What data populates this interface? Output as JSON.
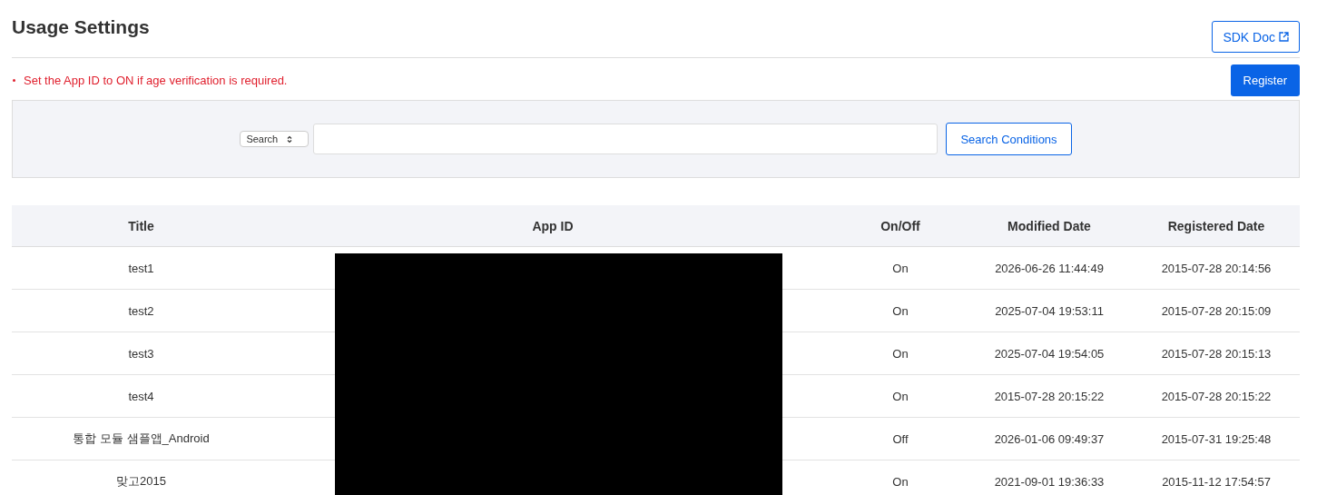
{
  "page": {
    "title": "Usage Settings",
    "doc_button": "SDK Doc",
    "notice": "Set the App ID to ON if age verification is required.",
    "register_button": "Register"
  },
  "search": {
    "select": "Search",
    "button": "Search Conditions"
  },
  "table": {
    "columns": [
      "Title",
      "App ID",
      "On/Off",
      "Modified Date",
      "Registered Date"
    ],
    "rows": [
      {
        "title": "test1",
        "on_off": "On",
        "modified": "2026-06-26 11:44:49",
        "registered": "2015-07-28 20:14:56"
      },
      {
        "title": "test2",
        "on_off": "On",
        "modified": "2025-07-04 19:53:11",
        "registered": "2015-07-28 20:15:09"
      },
      {
        "title": "test3",
        "on_off": "On",
        "modified": "2025-07-04 19:54:05",
        "registered": "2015-07-28 20:15:13"
      },
      {
        "title": "test4",
        "on_off": "On",
        "modified": "2015-07-28 20:15:22",
        "registered": "2015-07-28 20:15:22"
      },
      {
        "title": "통합 모듈 샘플앱_Android",
        "on_off": "Off",
        "modified": "2026-01-06 09:49:37",
        "registered": "2015-07-31 19:25:48"
      },
      {
        "title": "맞고2015",
        "on_off": "On",
        "modified": "2021-09-01 19:36:33",
        "registered": "2015-11-12 17:54:57"
      }
    ]
  }
}
